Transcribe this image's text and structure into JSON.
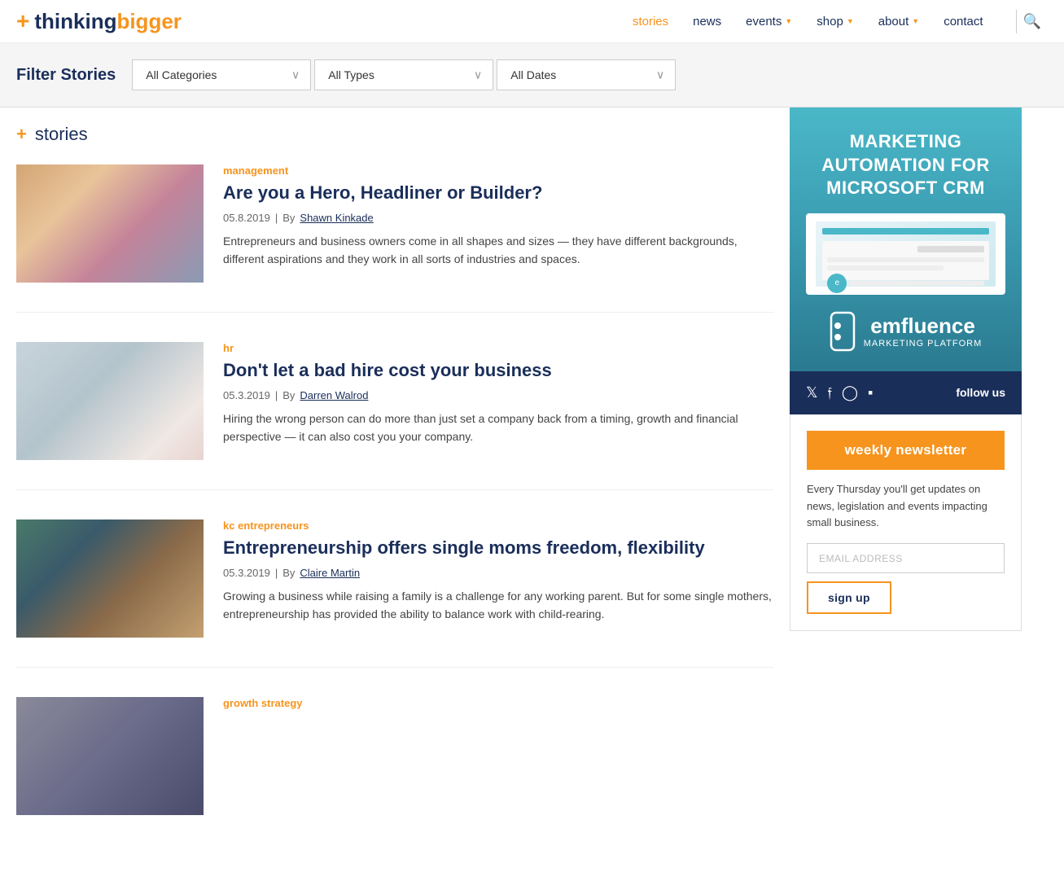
{
  "site": {
    "logo_plus": "+",
    "logo_thinking": "thinking",
    "logo_bigger": "bigger"
  },
  "nav": {
    "items": [
      {
        "label": "stories",
        "active": true,
        "has_dropdown": false
      },
      {
        "label": "news",
        "active": false,
        "has_dropdown": false
      },
      {
        "label": "events",
        "active": false,
        "has_dropdown": true
      },
      {
        "label": "shop",
        "active": false,
        "has_dropdown": true
      },
      {
        "label": "about",
        "active": false,
        "has_dropdown": true
      },
      {
        "label": "contact",
        "active": false,
        "has_dropdown": false
      }
    ]
  },
  "filter": {
    "label": "Filter Stories",
    "category_placeholder": "All Categories",
    "type_placeholder": "All Types",
    "date_placeholder": "All Dates"
  },
  "stories_heading": "stories",
  "articles": [
    {
      "category": "management",
      "title": "Are you a Hero, Headliner or Builder?",
      "date": "05.8.2019",
      "author": "Shawn Kinkade",
      "excerpt": "Entrepreneurs and business owners come in all shapes and sizes — they have different backgrounds, different aspirations and they work in all sorts of industries and spaces.",
      "thumb_class": "thumb-1"
    },
    {
      "category": "hr",
      "title": "Don't let a bad hire cost your business",
      "date": "05.3.2019",
      "author": "Darren Walrod",
      "excerpt": "Hiring the wrong person can do more than just set a company back from a timing, growth and financial perspective — it can also cost you your company.",
      "thumb_class": "thumb-2"
    },
    {
      "category": "kc entrepreneurs",
      "title": "Entrepreneurship offers single moms freedom, flexibility",
      "date": "05.3.2019",
      "author": "Claire Martin",
      "excerpt": "Growing a business while raising a family is a challenge for any working parent. But for some single mothers, entrepreneurship has provided the ability to balance work with child-rearing.",
      "thumb_class": "thumb-3"
    },
    {
      "category": "growth strategy",
      "title": "",
      "date": "",
      "author": "",
      "excerpt": "",
      "thumb_class": "thumb-4"
    }
  ],
  "sidebar": {
    "ad": {
      "title": "MARKETING AUTOMATION FOR MICROSOFT CRM",
      "logo_em": "emfluence",
      "logo_sub": "MARKETING PLATFORM"
    },
    "social": {
      "follow_label": "follow us"
    },
    "newsletter": {
      "button_label": "weekly newsletter",
      "description": "Every Thursday you'll get updates on news, legislation and events impacting small business.",
      "input_placeholder": "EMAIL ADDRESS",
      "signup_label": "sign up"
    }
  }
}
